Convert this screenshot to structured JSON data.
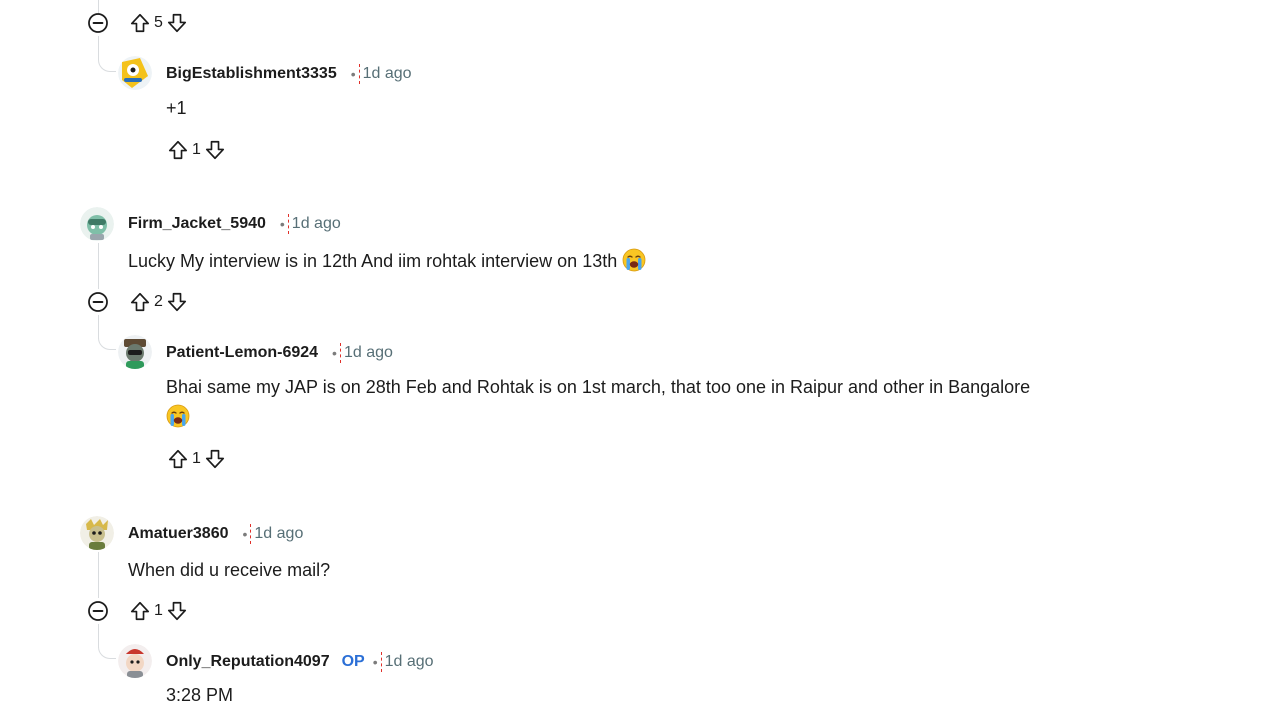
{
  "app": {
    "name": "Reddit comment thread"
  },
  "colors": {
    "op_badge": "#2b6fd6",
    "thread_line": "#d9dcdf",
    "time": "#576f76",
    "caret": "#e0302a"
  },
  "comments": [
    {
      "id": "c0",
      "score": "5",
      "reply": {
        "username": "BigEstablishment3335",
        "time": "1d ago",
        "text": "+1",
        "score": "1",
        "avatar_icon": "snoo-avatar-yellow-icon"
      }
    },
    {
      "id": "c1",
      "username": "Firm_Jacket_5940",
      "time": "1d ago",
      "text": "Lucky My interview is in 12th And iim rohtak interview on 13th",
      "emoji": "loudly-crying-face-icon",
      "score": "2",
      "avatar_icon": "snoo-avatar-teal-icon",
      "reply": {
        "username": "Patient-Lemon-6924",
        "time": "1d ago",
        "text": "Bhai same my JAP is on 28th Feb and Rohtak is on 1st march, that too one in Raipur and other in Bangalore",
        "emoji": "loudly-crying-face-icon",
        "score": "1",
        "avatar_icon": "snoo-avatar-dark-icon"
      }
    },
    {
      "id": "c2",
      "username": "Amatuer3860",
      "time": "1d ago",
      "text": "When did u receive mail?",
      "score": "1",
      "avatar_icon": "snoo-avatar-olive-icon",
      "reply": {
        "username": "Only_Reputation4097",
        "op_label": "OP",
        "time": "1d ago",
        "text": "3:28 PM",
        "avatar_icon": "snoo-avatar-red-icon"
      }
    }
  ],
  "separator": "•"
}
